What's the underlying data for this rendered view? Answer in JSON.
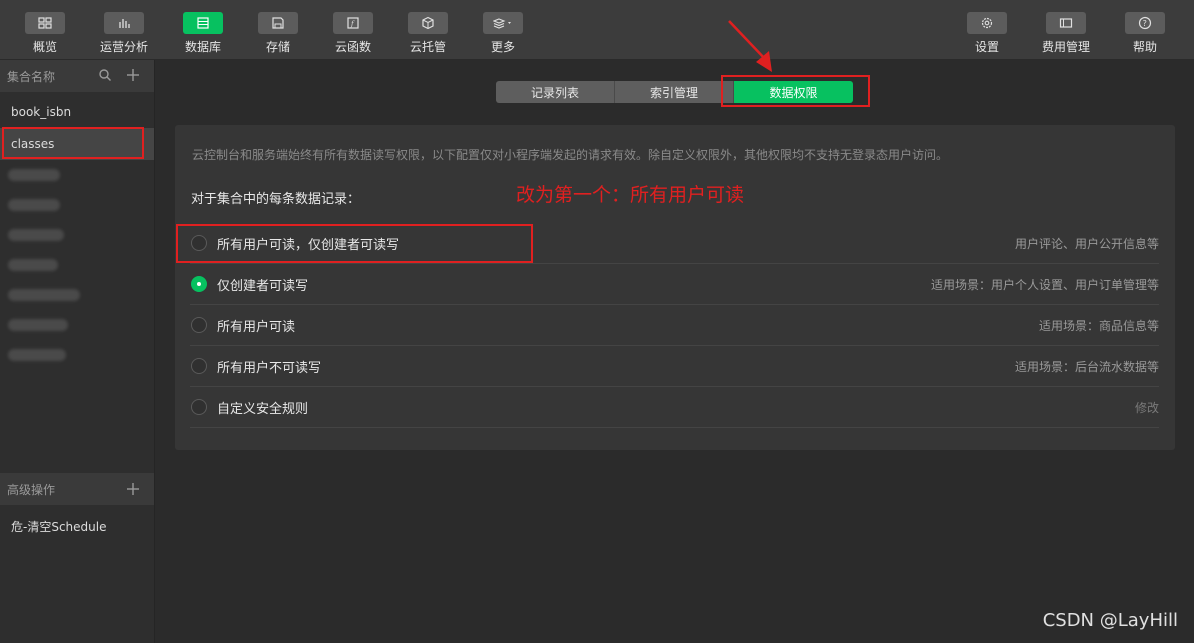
{
  "toolbar": {
    "left_items": [
      {
        "label": "概览",
        "icon": "grid-icon"
      },
      {
        "label": "运营分析",
        "icon": "bar-chart-icon"
      },
      {
        "label": "数据库",
        "icon": "database-icon",
        "active": true
      },
      {
        "label": "存储",
        "icon": "save-icon"
      },
      {
        "label": "云函数",
        "icon": "function-icon"
      },
      {
        "label": "云托管",
        "icon": "cube-icon"
      },
      {
        "label": "更多",
        "icon": "layers-icon"
      }
    ],
    "right_items": [
      {
        "label": "设置",
        "icon": "gear-icon"
      },
      {
        "label": "费用管理",
        "icon": "billing-icon"
      },
      {
        "label": "帮助",
        "icon": "help-icon"
      }
    ]
  },
  "sidebar": {
    "header": "集合名称",
    "collections": [
      "book_isbn",
      "classes"
    ],
    "selected": "classes",
    "advanced_header": "高级操作",
    "advanced_items": [
      "危-清空Schedule"
    ]
  },
  "tabs": [
    "记录列表",
    "索引管理",
    "数据权限"
  ],
  "active_tab": "数据权限",
  "panel": {
    "hint": "云控制台和服务端始终有所有数据读写权限，以下配置仅对小程序端发起的请求有效。除自定义权限外，其他权限均不支持无登录态用户访问。",
    "section_label": "对于集合中的每条数据记录：",
    "options": [
      {
        "label": "所有用户可读，仅创建者可读写",
        "note": "用户评论、用户公开信息等",
        "checked": false
      },
      {
        "label": "仅创建者可读写",
        "note": "适用场景：用户个人设置、用户订单管理等",
        "checked": true
      },
      {
        "label": "所有用户可读",
        "note": "适用场景：商品信息等",
        "checked": false
      },
      {
        "label": "所有用户不可读写",
        "note": "适用场景：后台流水数据等",
        "checked": false
      },
      {
        "label": "自定义安全规则",
        "note": "修改",
        "checked": false
      }
    ]
  },
  "annotation": {
    "text": "改为第一个：所有用户可读",
    "color": "#e02020"
  },
  "watermark": "CSDN @LayHill",
  "colors": {
    "accent": "#07c160",
    "annotation": "#e02020"
  }
}
